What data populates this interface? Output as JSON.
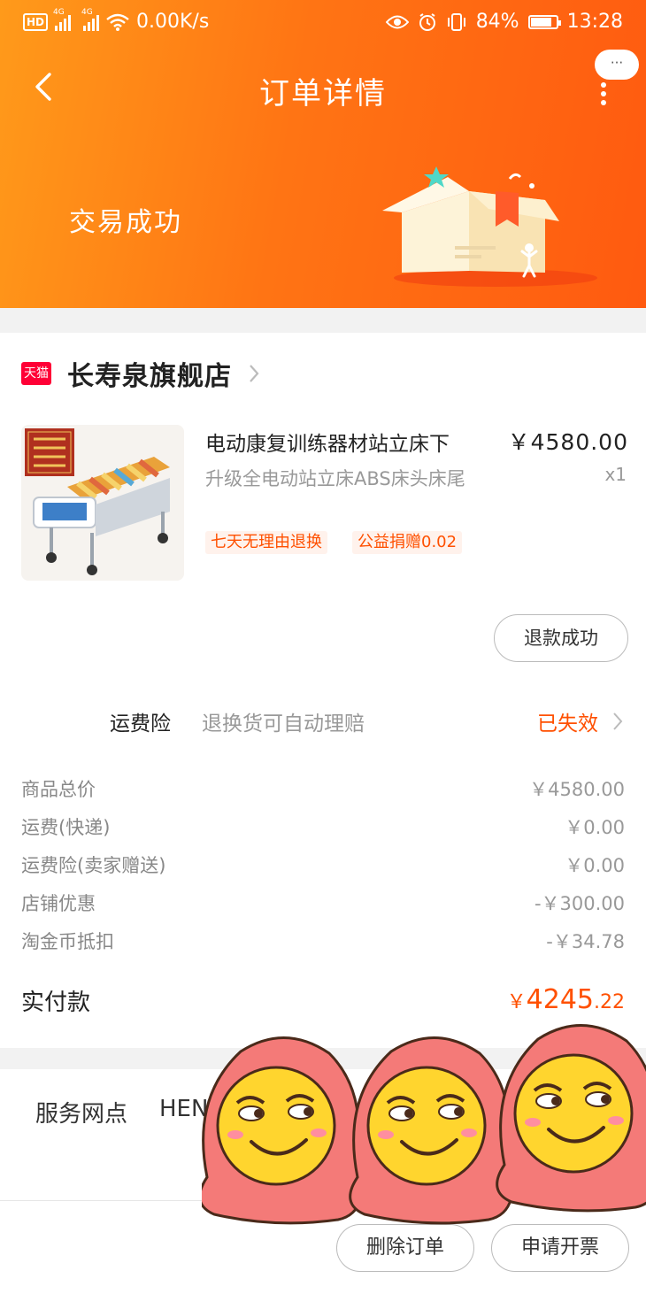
{
  "status_bar": {
    "hd": "HD",
    "net1": "4G",
    "net2": "4G",
    "speed": "0.00K/s",
    "battery": "84%",
    "battery_level": 0.84,
    "time": "13:28"
  },
  "nav": {
    "title": "订单详情",
    "more_bubble": "···"
  },
  "order_status": "交易成功",
  "shop": {
    "badge": "天猫",
    "name": "长寿泉旗舰店"
  },
  "product": {
    "title": "电动康复训练器材站立床下",
    "sku": "升级全电动站立床ABS床头床尾",
    "price": "￥4580.00",
    "quantity": "x1",
    "tags": [
      "七天无理由退换",
      "公益捐赠0.02"
    ],
    "refund_button": "退款成功"
  },
  "shipping_insurance": {
    "label": "运费险",
    "desc": "退换货可自动理赔",
    "status": "已失效"
  },
  "fees": [
    {
      "label": "商品总价",
      "value": "￥4580.00"
    },
    {
      "label": "运费(快递)",
      "value": "￥0.00"
    },
    {
      "label": "运费险(卖家赠送)",
      "value": "￥0.00"
    },
    {
      "label": "店铺优惠",
      "value": "-￥300.00"
    },
    {
      "label": "淘金币抵扣",
      "value": "-￥34.78"
    }
  ],
  "paid": {
    "label": "实付款",
    "currency": "￥",
    "integer": "4245",
    "decimal": ".22"
  },
  "service": {
    "label": "服务网点",
    "value": "HEN"
  },
  "bottom": {
    "delete": "删除订单",
    "invoice": "申请开票"
  },
  "colors": {
    "accent": "#ff5000",
    "header_start": "#ff9a1a",
    "header_end": "#ff5a10",
    "tmall": "#ff0036"
  }
}
